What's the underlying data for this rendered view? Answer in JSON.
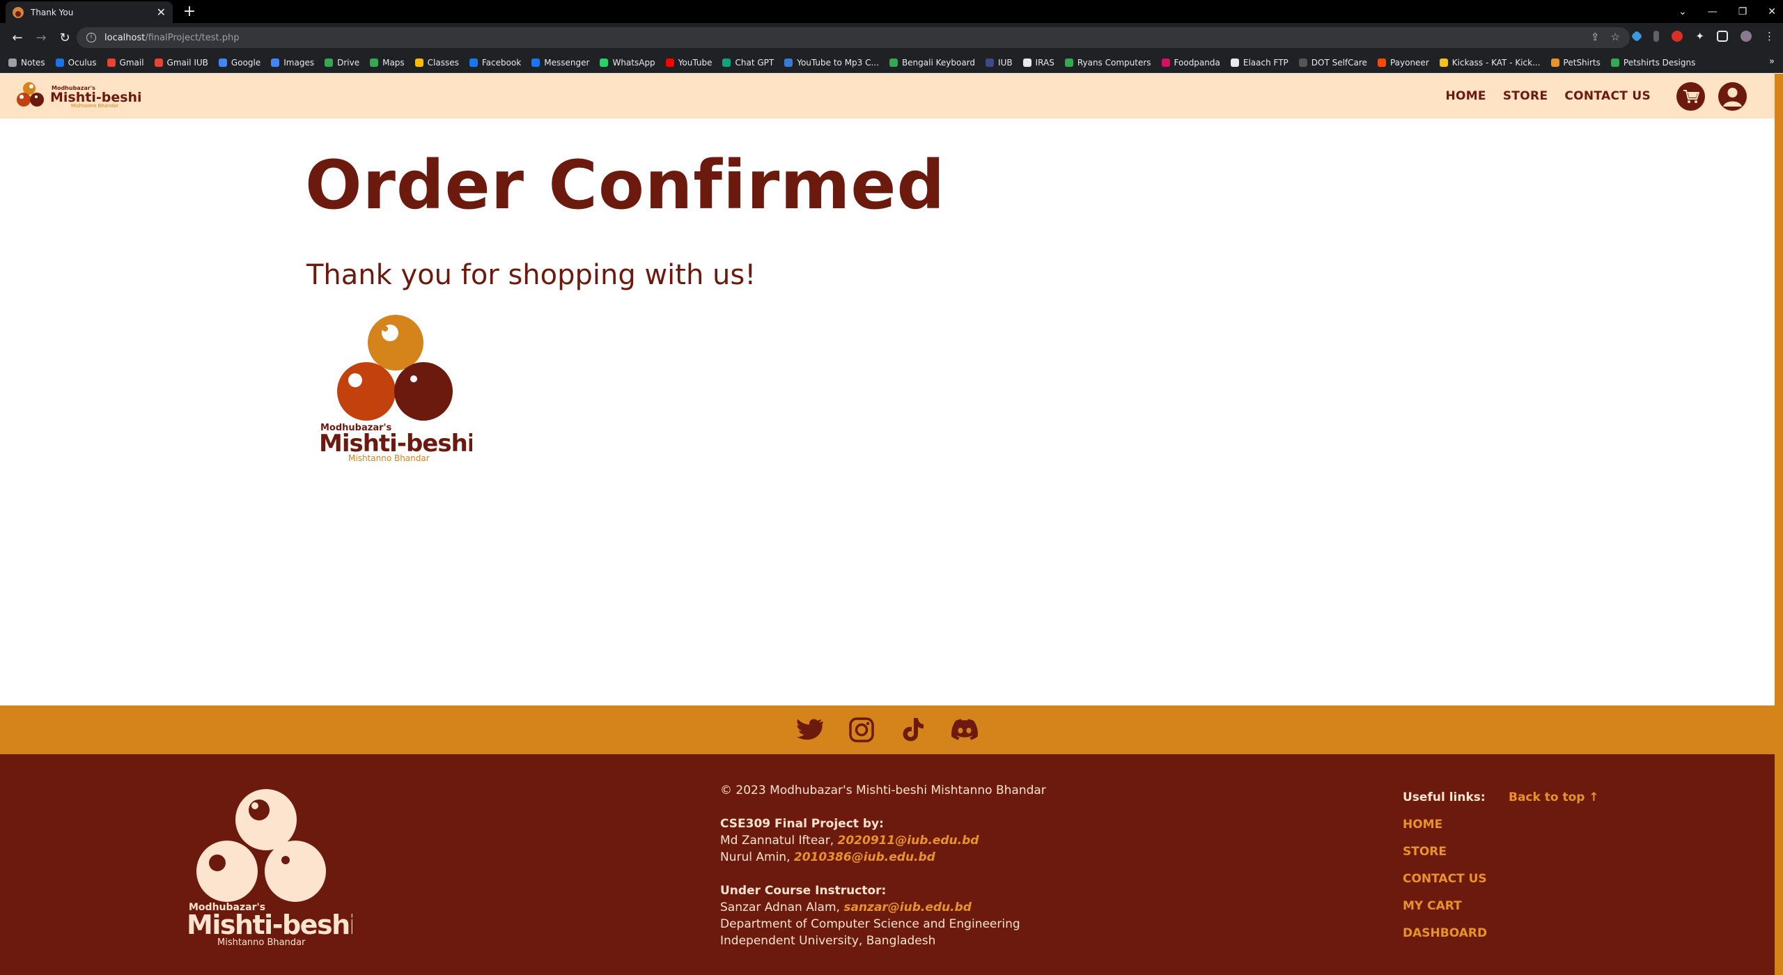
{
  "browser": {
    "tab_title": "Thank You",
    "url_host": "localhost",
    "url_path": "/finalProject/test.php",
    "bookmarks": [
      {
        "label": "Notes",
        "color": "#9aa0a6"
      },
      {
        "label": "Oculus",
        "color": "#1a73e8"
      },
      {
        "label": "Gmail",
        "color": "#ea4335"
      },
      {
        "label": "Gmail IUB",
        "color": "#ea4335"
      },
      {
        "label": "Google",
        "color": "#4285f4"
      },
      {
        "label": "Images",
        "color": "#4285f4"
      },
      {
        "label": "Drive",
        "color": "#34a853"
      },
      {
        "label": "Maps",
        "color": "#34a853"
      },
      {
        "label": "Classes",
        "color": "#fbbc04"
      },
      {
        "label": "Facebook",
        "color": "#1877f2"
      },
      {
        "label": "Messenger",
        "color": "#1877f2"
      },
      {
        "label": "WhatsApp",
        "color": "#25d366"
      },
      {
        "label": "YouTube",
        "color": "#ff0000"
      },
      {
        "label": "Chat GPT",
        "color": "#10a37f"
      },
      {
        "label": "YouTube to Mp3 C...",
        "color": "#3a7bd5"
      },
      {
        "label": "Bengali Keyboard",
        "color": "#34a853"
      },
      {
        "label": "IUB",
        "color": "#3c4a8a"
      },
      {
        "label": "IRAS",
        "color": "#e8eaed"
      },
      {
        "label": "Ryans Computers",
        "color": "#34a853"
      },
      {
        "label": "Foodpanda",
        "color": "#d70f64"
      },
      {
        "label": "Elaach FTP",
        "color": "#e8eaed"
      },
      {
        "label": "DOT SelfCare",
        "color": "#555555"
      },
      {
        "label": "Payoneer",
        "color": "#ff4800"
      },
      {
        "label": "Kickass - KAT - Kick...",
        "color": "#f3c31a"
      },
      {
        "label": "PetShirts",
        "color": "#e8932a"
      },
      {
        "label": "Petshirts Designs",
        "color": "#34a853"
      }
    ]
  },
  "nav": {
    "logo_top": "Modhubazar's",
    "logo_main": "Mishti-beshi",
    "logo_sub": "Mishtanno Bhandar",
    "links": [
      "HOME",
      "STORE",
      "CONTACT US"
    ]
  },
  "main": {
    "title": "Order Confirmed",
    "subtitle": "Thank you for shopping with us!"
  },
  "footer": {
    "copyright": "© 2023 Modhubazar's Mishti-beshi Mishtanno Bhandar",
    "project_heading": "CSE309 Final Project by:",
    "author1_name": "Md Zannatul Iftear,",
    "author1_email": "2020911@iub.edu.bd",
    "author2_name": "Nurul Amin,",
    "author2_email": "2010386@iub.edu.bd",
    "instructor_heading": "Under Course Instructor:",
    "instructor_name": "Sanzar Adnan Alam,",
    "instructor_email": "sanzar@iub.edu.bd",
    "department": "Department of Computer Science and Engineering",
    "university": "Independent University, Bangladesh",
    "useful_links_label": "Useful links:",
    "back_to_top": "Back to top ↑",
    "links": [
      "HOME",
      "STORE",
      "CONTACT US",
      "MY CART",
      "DASHBOARD"
    ]
  },
  "colors": {
    "brand_dark": "#6d1a0e",
    "brand_orange": "#d5831b",
    "nav_bg": "#ffe3c4"
  },
  "icons": [
    "twitter-icon",
    "instagram-icon",
    "tiktok-icon",
    "discord-icon",
    "cart-icon",
    "user-icon"
  ]
}
